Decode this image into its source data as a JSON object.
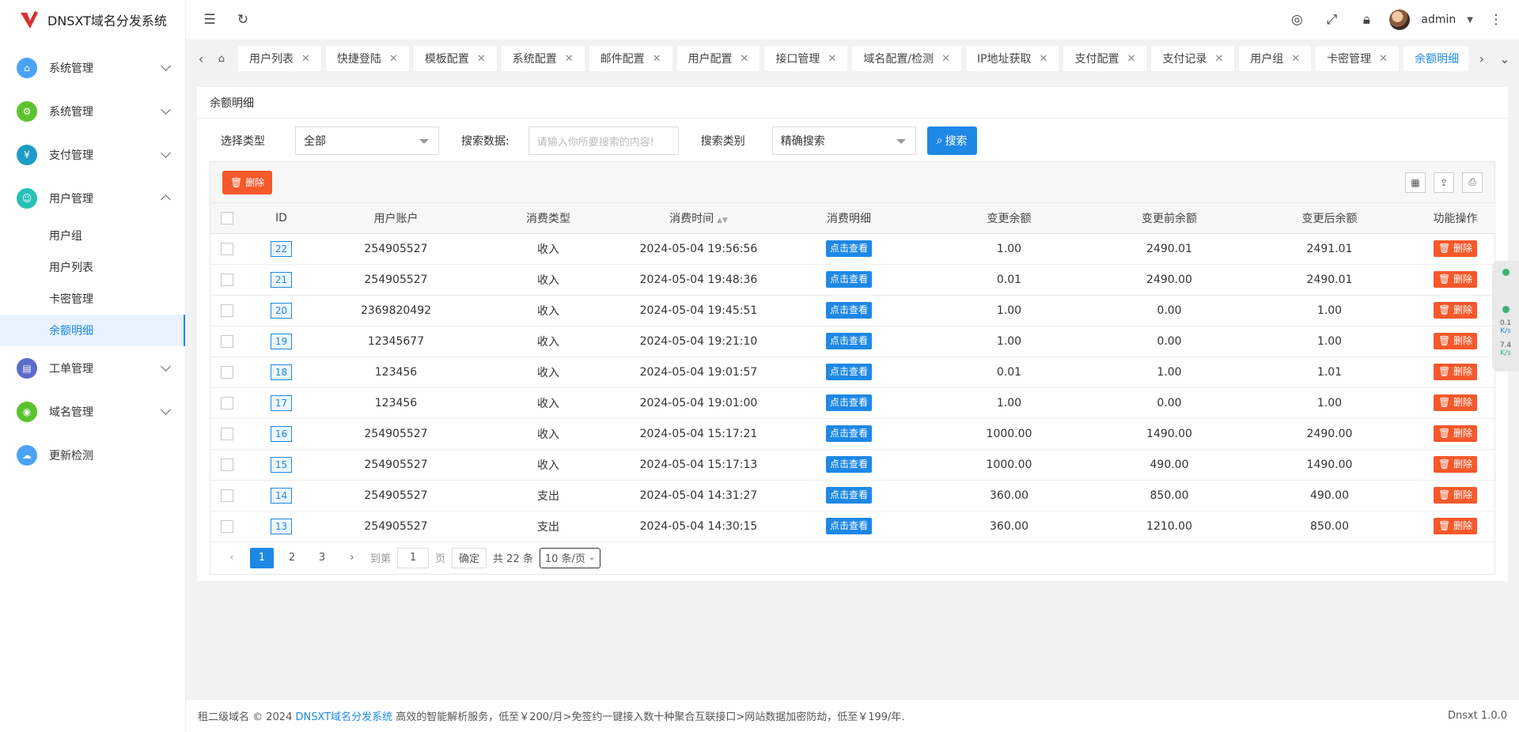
{
  "app": {
    "title": "DNSXT域名分发系统"
  },
  "sidebar": {
    "items": [
      {
        "label": "系统管理",
        "color": "#4aa3f5",
        "icon": "home-icon",
        "expanded": false
      },
      {
        "label": "系统管理",
        "color": "#5cc22e",
        "icon": "gear-icon",
        "expanded": false
      },
      {
        "label": "支付管理",
        "color": "#1e9bc7",
        "icon": "pay-icon",
        "expanded": false
      },
      {
        "label": "用户管理",
        "color": "#27c2b5",
        "icon": "user-icon",
        "expanded": true
      },
      {
        "label": "工单管理",
        "color": "#5b6cc9",
        "icon": "ticket-icon",
        "expanded": false
      },
      {
        "label": "域名管理",
        "color": "#5cc22e",
        "icon": "domain-icon",
        "expanded": false
      },
      {
        "label": "更新检测",
        "color": "#4aa3f5",
        "icon": "cloud-icon",
        "expanded": false
      }
    ],
    "submenu": [
      "用户组",
      "用户列表",
      "卡密管理",
      "余额明细"
    ]
  },
  "header": {
    "user": "admin"
  },
  "tabs": [
    "用户列表",
    "快捷登陆",
    "模板配置",
    "系统配置",
    "邮件配置",
    "用户配置",
    "接口管理",
    "域名配置/检测",
    "IP地址获取",
    "支付配置",
    "支付记录",
    "用户组",
    "卡密管理",
    "余额明细"
  ],
  "card": {
    "title": "余额明细"
  },
  "filter": {
    "type_label": "选择类型",
    "type_value": "全部",
    "search_label": "搜索数据:",
    "search_placeholder": "请输入你所要搜索的内容!",
    "category_label": "搜索类别",
    "category_value": "精确搜索",
    "search_button": "搜索"
  },
  "toolbar": {
    "delete_label": "删除"
  },
  "table": {
    "headers": [
      "ID",
      "用户账户",
      "消费类型",
      "消费时间",
      "消费明细",
      "变更余额",
      "变更前余额",
      "变更后余额",
      "功能操作"
    ],
    "view_label": "点击查看",
    "delete_label": "删除",
    "rows": [
      {
        "id": "22",
        "account": "254905527",
        "type": "收入",
        "time": "2024-05-04 19:56:56",
        "change": "1.00",
        "before": "2490.01",
        "after": "2491.01"
      },
      {
        "id": "21",
        "account": "254905527",
        "type": "收入",
        "time": "2024-05-04 19:48:36",
        "change": "0.01",
        "before": "2490.00",
        "after": "2490.01"
      },
      {
        "id": "20",
        "account": "2369820492",
        "type": "收入",
        "time": "2024-05-04 19:45:51",
        "change": "1.00",
        "before": "0.00",
        "after": "1.00"
      },
      {
        "id": "19",
        "account": "12345677",
        "type": "收入",
        "time": "2024-05-04 19:21:10",
        "change": "1.00",
        "before": "0.00",
        "after": "1.00"
      },
      {
        "id": "18",
        "account": "123456",
        "type": "收入",
        "time": "2024-05-04 19:01:57",
        "change": "0.01",
        "before": "1.00",
        "after": "1.01"
      },
      {
        "id": "17",
        "account": "123456",
        "type": "收入",
        "time": "2024-05-04 19:01:00",
        "change": "1.00",
        "before": "0.00",
        "after": "1.00"
      },
      {
        "id": "16",
        "account": "254905527",
        "type": "收入",
        "time": "2024-05-04 15:17:21",
        "change": "1000.00",
        "before": "1490.00",
        "after": "2490.00"
      },
      {
        "id": "15",
        "account": "254905527",
        "type": "收入",
        "time": "2024-05-04 15:17:13",
        "change": "1000.00",
        "before": "490.00",
        "after": "1490.00"
      },
      {
        "id": "14",
        "account": "254905527",
        "type": "支出",
        "time": "2024-05-04 14:31:27",
        "change": "360.00",
        "before": "850.00",
        "after": "490.00"
      },
      {
        "id": "13",
        "account": "254905527",
        "type": "支出",
        "time": "2024-05-04 14:30:15",
        "change": "360.00",
        "before": "1210.00",
        "after": "850.00"
      }
    ]
  },
  "pager": {
    "pages": [
      "1",
      "2",
      "3"
    ],
    "goto_label": "到第",
    "goto_value": "1",
    "page_unit": "页",
    "confirm": "确定",
    "total": "共 22 条",
    "size": "10 条/页"
  },
  "footer": {
    "prefix": "租二级域名 © 2024",
    "link": "DNSXT域名分发系统",
    "text": "高效的智能解析服务，低至￥200/月>免签约一键接入数十种聚合互联接口>网站数据加密防劫，低至￥199/年.",
    "version": "Dnsxt 1.0.0"
  },
  "widget": {
    "up": "0.1",
    "up_unit": "K/s",
    "down": "7.4",
    "down_unit": "K/s"
  }
}
